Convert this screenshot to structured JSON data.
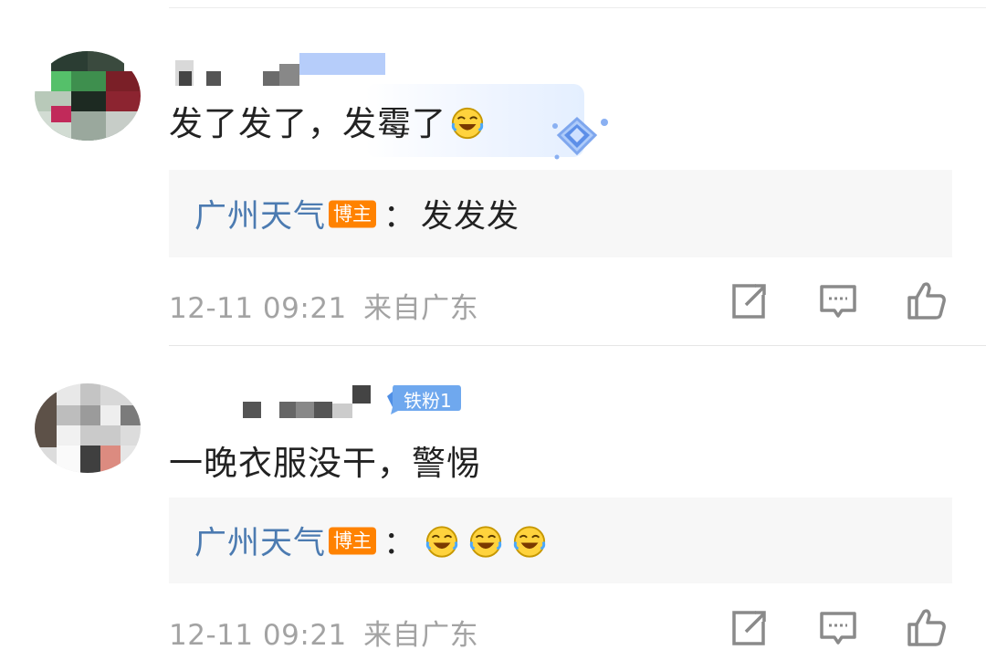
{
  "comments": [
    {
      "text": "发了发了，发霉了",
      "emoji_icon": "laughing-crying-emoji",
      "reply": {
        "author": "广州天气",
        "role_badge": "博主",
        "colon": "：",
        "text": "发发发"
      },
      "time": "12-11 09:21",
      "location": "来自广东"
    },
    {
      "fan_badge": "铁粉1",
      "text": "一晚衣服没干，警惕",
      "reply": {
        "author": "广州天气",
        "role_badge": "博主",
        "colon": "：",
        "emojis": [
          "laughing-crying-emoji",
          "laughing-crying-emoji",
          "laughing-crying-emoji"
        ]
      },
      "time": "12-11 09:21",
      "location": "来自广东"
    }
  ],
  "actions": [
    "share-icon",
    "comment-icon",
    "like-icon"
  ],
  "colors": {
    "author": "#4c7bb1",
    "badge": "#ff8200",
    "meta": "#a3a3a3",
    "reply_bg": "#f7f7f7",
    "fan_badge": "#6fa8ee"
  }
}
